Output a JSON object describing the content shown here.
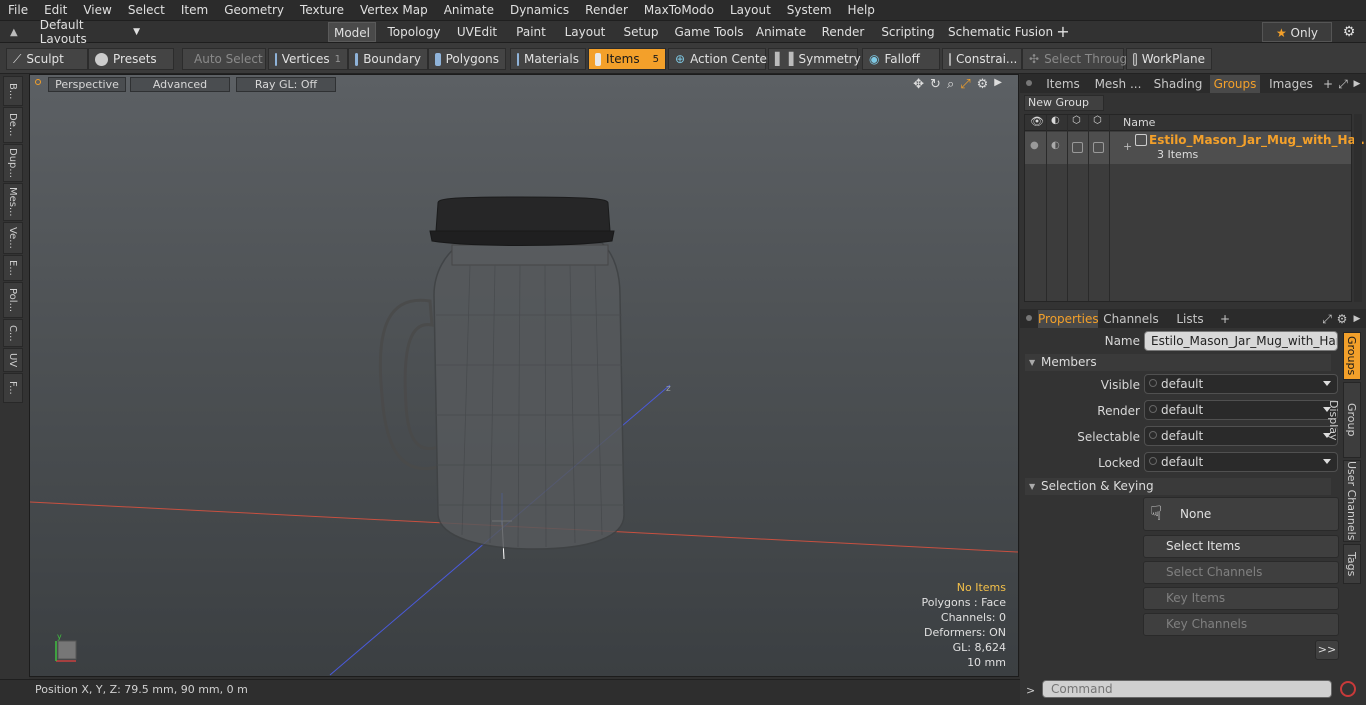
{
  "menu": [
    "File",
    "Edit",
    "View",
    "Select",
    "Item",
    "Geometry",
    "Texture",
    "Vertex Map",
    "Animate",
    "Dynamics",
    "Render",
    "MaxToModo",
    "Layout",
    "System",
    "Help"
  ],
  "layouts_label": "Default Layouts",
  "mode_tabs": [
    "Model",
    "Topology",
    "UVEdit",
    "Paint",
    "Layout",
    "Setup",
    "Game Tools",
    "Animate",
    "Render",
    "Scripting",
    "Schematic Fusion"
  ],
  "only_label": "Only",
  "toolbar": {
    "sculpt": "Sculpt",
    "presets": "Presets",
    "auto_select": "Auto Select",
    "vertices": "Vertices",
    "vertices_count": "1",
    "boundary": "Boundary",
    "polygons": "Polygons",
    "materials": "Materials",
    "items": "Items",
    "items_count": "5",
    "action_center": "Action Center",
    "symmetry": "Symmetry",
    "falloff": "Falloff",
    "constrain": "Constrai...",
    "select_through": "Select Through",
    "workplane": "WorkPlane"
  },
  "left_tabs": [
    "B...",
    "De...",
    "Dup...",
    "Mes...",
    "Ve...",
    "E...",
    "Pol...",
    "C...",
    "UV",
    "F..."
  ],
  "viewport": {
    "perspective": "Perspective",
    "advanced": "Advanced",
    "raygl": "Ray GL: Off",
    "info": {
      "items": "No Items",
      "polygons": "Polygons : Face",
      "channels": "Channels: 0",
      "deformers": "Deformers: ON",
      "gl": "GL: 8,624",
      "scale": "10 mm"
    }
  },
  "status": "Position X, Y, Z:   79.5 mm, 90 mm, 0 m",
  "top_panel": {
    "tabs": [
      "Items",
      "Mesh ...",
      "Shading",
      "Groups",
      "Images"
    ],
    "new_group": "New Group",
    "col_name": "Name",
    "group_name": "Estilo_Mason_Jar_Mug_with_Ha...",
    "group_count": "3 Items"
  },
  "props": {
    "tabs": [
      "Properties",
      "Channels",
      "Lists"
    ],
    "name_label": "Name",
    "name_value": "Estilo_Mason_Jar_Mug_with_Handle (",
    "members": "Members",
    "visible_label": "Visible",
    "render_label": "Render",
    "selectable_label": "Selectable",
    "locked_label": "Locked",
    "default_value": "default",
    "selection_keying": "Selection & Keying",
    "none_label": "None",
    "select_items": "Select Items",
    "select_channels": "Select Channels",
    "key_items": "Key Items",
    "key_channels": "Key Channels",
    "more": ">>"
  },
  "right_tabs": [
    "Groups",
    "Group Display",
    "User Channels",
    "Tags"
  ],
  "command_placeholder": "Command",
  "colors": {
    "accent": "#f3a02a"
  }
}
